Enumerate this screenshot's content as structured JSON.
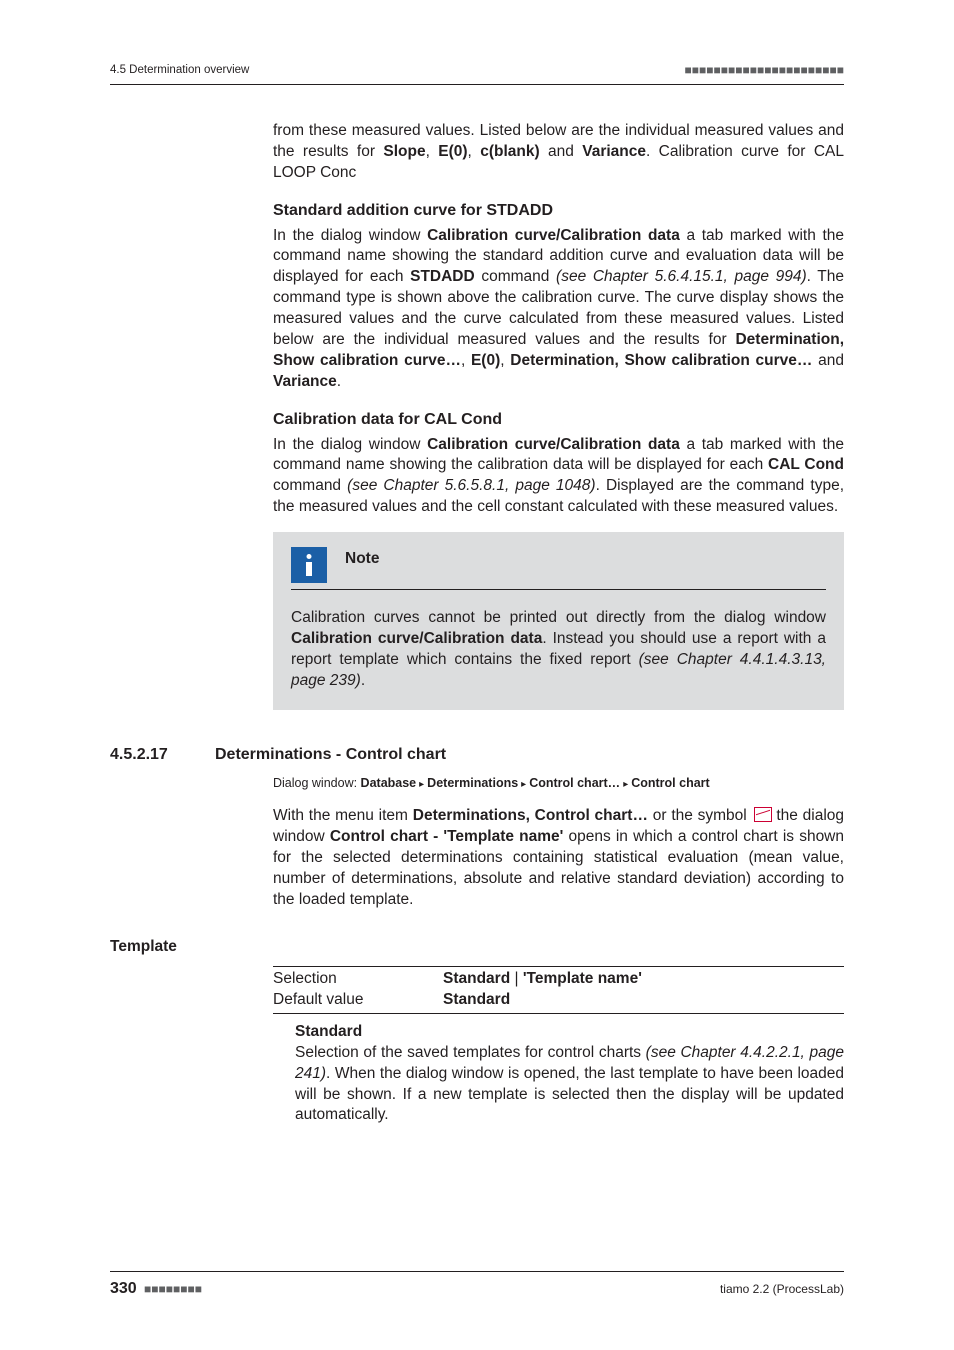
{
  "header": {
    "left": "4.5 Determination overview",
    "dots": "■■■■■■■■■■■■■■■■■■■■■■"
  },
  "intro_line_1": "from these measured values. Listed below are the individual measured values and the results for ",
  "intro_slope": "Slope",
  "intro_sep": ", ",
  "intro_e0": "E(0)",
  "intro_cblank": "c(blank)",
  "intro_and": " and ",
  "intro_variance": "Variance",
  "intro_tail": ". Calibration curve for CAL LOOP Conc",
  "h_stdadd": "Standard addition curve for STDADD",
  "stdadd_p1_a": "In the dialog window ",
  "stdadd_p1_b": "Calibration curve/Calibration data",
  "stdadd_p1_c": " a tab marked with the command name showing the standard addition curve and evalua­tion data will be displayed for each ",
  "stdadd_bold": "STDADD",
  "stdadd_p1_d": " command ",
  "stdadd_em1": "(see Chapter 5.6.4.15.1, page 994)",
  "stdadd_p1_e": ". The command type is shown above the calibration curve. The curve display shows the measured values and the curve calculated from these measured values. Listed below are the individual measured values and the results for ",
  "stdadd_b2": "Determination, Show calibration curve…",
  "stdadd_p1_f": ", ",
  "stdadd_b3": "E(0)",
  "stdadd_p1_g": ", ",
  "stdadd_b4": "Determination, Show calibration curve…",
  "stdadd_p1_h": " and ",
  "stdadd_b5": "Variance",
  "stdadd_p1_i": ".",
  "h_calcond": "Calibration data for CAL Cond",
  "calcond_p_a": "In the dialog window ",
  "calcond_p_b": "Calibration curve/Calibration data",
  "calcond_p_c": " a tab marked with the command name showing the calibration data will be displayed for each ",
  "calcond_bold": "CAL Cond",
  "calcond_p_d": " command ",
  "calcond_em": "(see Chapter 5.6.5.8.1, page 1048)",
  "calcond_p_e": ". Displayed are the command type, the measured values and the cell constant calculated with these measured values.",
  "note_label": "Note",
  "note_body_a": "Calibration curves cannot be printed out directly from the dialog window ",
  "note_body_b": "Calibration curve/Calibration data",
  "note_body_c": ". Instead you should use a report with a report template which contains the fixed report ",
  "note_body_em": "(see Chapter 4.4.1.4.3.13, page 239)",
  "note_body_d": ".",
  "sec_num": "4.5.2.17",
  "sec_title": "Determinations - Control chart",
  "path_prefix": "Dialog window: ",
  "path_p1": "Database",
  "path_p2": "Determinations",
  "path_p3": "Control chart…",
  "path_p4": "Control chart",
  "cc_p_a": "With the menu item ",
  "cc_p_b": "Determinations, Control chart…",
  "cc_p_c": " or the symbol ",
  "cc_p_d": " the dialog window ",
  "cc_p_e": "Control chart - 'Template name'",
  "cc_p_f": " opens in which a control chart is shown for the selected determinations containing statistical evaluation (mean value, number of determinations, absolute and relative standard deviation) according to the loaded template.",
  "side_template": "Template",
  "row_sel_k": "Selection",
  "row_sel_v1": "Standard",
  "row_sel_sep": " | ",
  "row_sel_v2": "'Template name'",
  "row_def_k": "Default value",
  "row_def_v": "Standard",
  "sub_title": "Standard",
  "sub_body_a": "Selection of the saved templates for control charts ",
  "sub_body_em": "(see Chapter 4.4.2.2.1, page 241)",
  "sub_body_b": ". When the dialog window is opened, the last tem­plate to have been loaded will be shown. If a new template is selected then the display will be updated automatically.",
  "footer": {
    "page": "330",
    "dots": "■■■■■■■■",
    "right": "tiamo 2.2 (ProcessLab)"
  }
}
